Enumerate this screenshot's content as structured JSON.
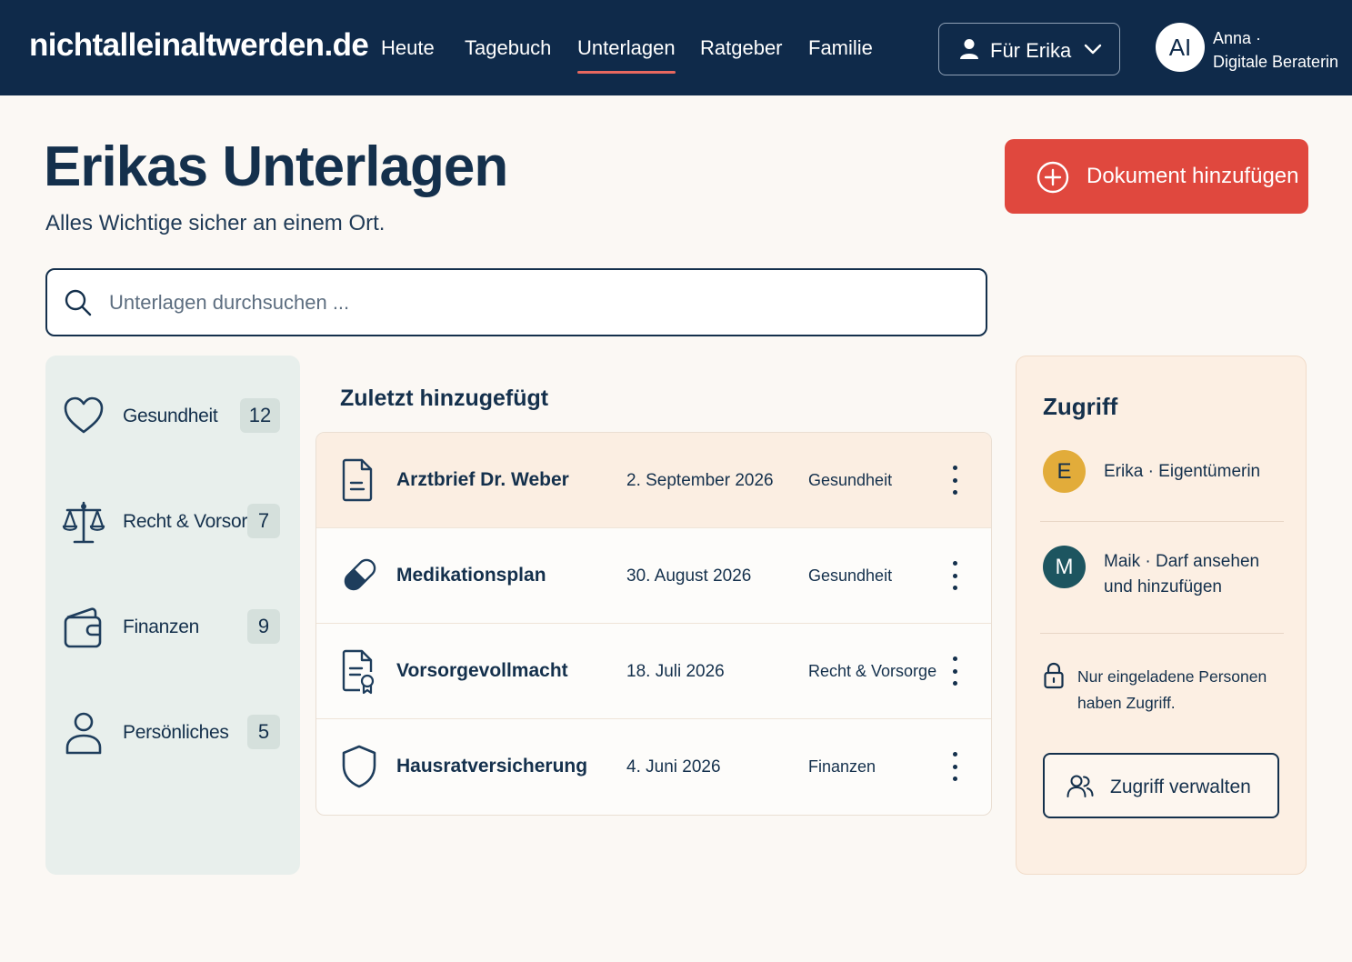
{
  "header": {
    "logo": "nichtalleinaltwerden.de",
    "nav": [
      {
        "label": "Heute"
      },
      {
        "label": "Tagebuch"
      },
      {
        "label": "Unterlagen"
      },
      {
        "label": "Ratgeber"
      },
      {
        "label": "Familie"
      }
    ],
    "active_nav": "Unterlagen",
    "person_selector": {
      "label": "Für Erika"
    },
    "user": {
      "initials": "AI",
      "name": "Anna ·",
      "role": "Digitale Beraterin"
    }
  },
  "main": {
    "title": "Erikas Unterlagen",
    "subtitle": "Alles Wichtige sicher an einem Ort.",
    "add_button": "Dokument hinzufügen",
    "search": {
      "placeholder": "Unterlagen durchsuchen ...",
      "value": ""
    }
  },
  "categories": [
    {
      "label": "Gesundheit",
      "count": "12",
      "icon": "heart-icon"
    },
    {
      "label": "Recht & Vorsorge",
      "count": "7",
      "icon": "scales-icon"
    },
    {
      "label": "Finanzen",
      "count": "9",
      "icon": "wallet-icon"
    },
    {
      "label": "Persönliches",
      "count": "5",
      "icon": "person-icon"
    }
  ],
  "recent": {
    "heading": "Zuletzt hinzugefügt",
    "documents": [
      {
        "name": "Arztbrief Dr. Weber",
        "date": "2. September 2026",
        "category": "Gesundheit",
        "icon": "document-icon"
      },
      {
        "name": "Medikationsplan",
        "date": "30. August 2026",
        "category": "Gesundheit",
        "icon": "pill-icon"
      },
      {
        "name": "Vorsorgevollmacht",
        "date": "18. Juli 2026",
        "category": "Recht & Vorsorge",
        "icon": "certificate-document-icon"
      },
      {
        "name": "Hausratversicherung",
        "date": "4. Juni 2026",
        "category": "Finanzen",
        "icon": "shield-icon"
      }
    ]
  },
  "access": {
    "title": "Zugriff",
    "members": [
      {
        "initial": "E",
        "text": "Erika · Eigentümerin",
        "color": "#e2ac3a"
      },
      {
        "initial": "M",
        "text_line1": "Maik · Darf ansehen",
        "text_line2": "und hinzufügen",
        "color": "#1d5560"
      }
    ],
    "note": "Nur eingeladene Personen haben Zugriff.",
    "manage_button": "Zugriff verwalten"
  },
  "colors": {
    "header_bg": "#0f2a4a",
    "accent": "#e0483e",
    "nav_underline": "#e8685f",
    "text": "#14304c",
    "sidebar_bg": "#e8efec",
    "access_bg": "#fcefe3",
    "highlight_row": "#fbeee2"
  }
}
